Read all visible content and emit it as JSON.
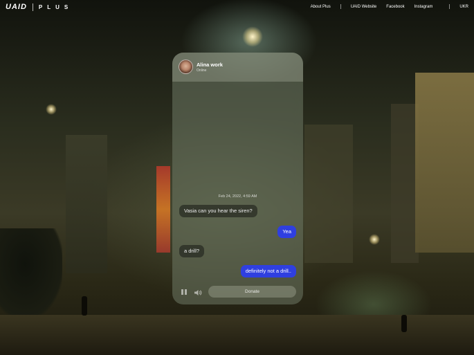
{
  "brand": {
    "logo": "UAID",
    "sub": "PLUS"
  },
  "nav": {
    "items": [
      "About Plus",
      "UAID Website",
      "Facebook",
      "Instagram"
    ],
    "lang": "UKR"
  },
  "chat": {
    "contact": {
      "name": "Alina work",
      "status": "Online"
    },
    "timestamp": "Feb 24, 2022, 4:59 AM",
    "messages": [
      {
        "from": "them",
        "text": "Vasia can you hear the siren?"
      },
      {
        "from": "me",
        "text": "Yea"
      },
      {
        "from": "them",
        "text": "a drill?"
      },
      {
        "from": "me",
        "text": "definitely not a drill.."
      }
    ],
    "controls": {
      "donate_label": "Donate",
      "pause_icon": "pause-icon",
      "volume_icon": "volume-icon"
    }
  },
  "colors": {
    "accent": "#2f3fe0",
    "panel": "#6e7864"
  }
}
